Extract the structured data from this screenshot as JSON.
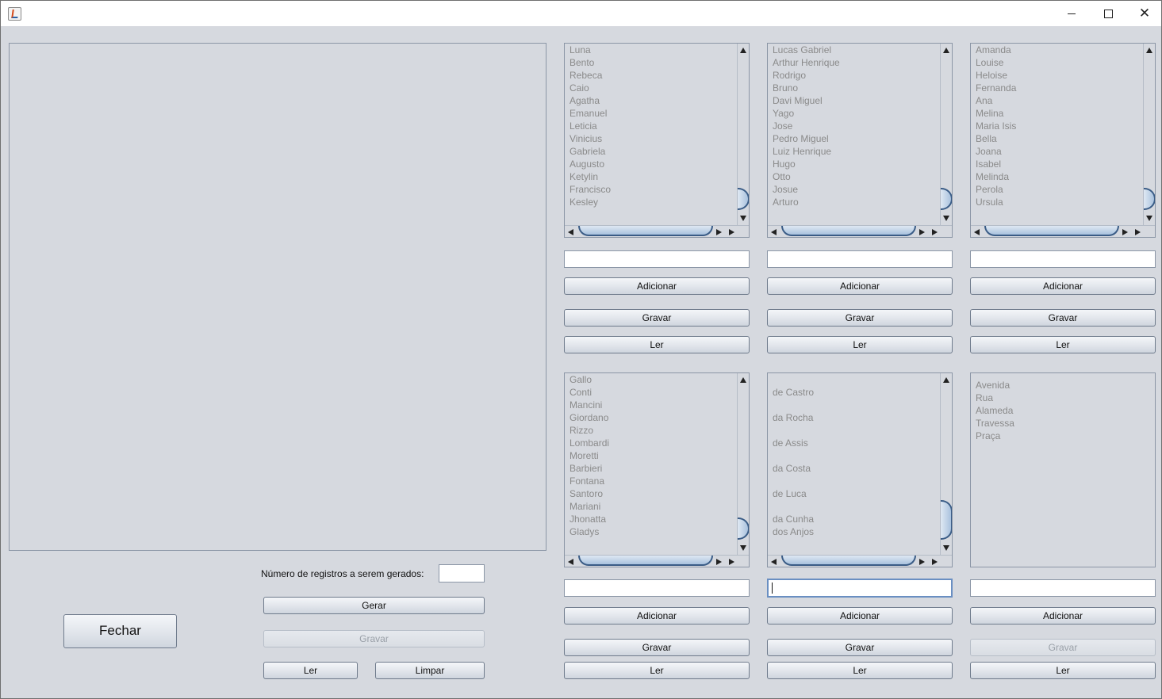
{
  "window": {
    "title": "",
    "controls": {
      "minimize": "minimize-icon",
      "maximize": "maximize-icon",
      "close": "✕"
    }
  },
  "lists": [
    {
      "items": [
        "Luna",
        "Bento",
        "Rebeca",
        "Caio",
        "Agatha",
        "Emanuel",
        "Leticia",
        "Vinicius",
        "Gabriela",
        "Augusto",
        "Ketylin",
        "Francisco",
        "Kesley"
      ]
    },
    {
      "items": [
        "Lucas Gabriel",
        "Arthur Henrique",
        "Rodrigo",
        "Bruno",
        "Davi Miguel",
        "Yago",
        "Jose",
        "Pedro Miguel",
        "Luiz Henrique",
        "Hugo",
        "Otto",
        "Josue",
        "Arturo"
      ]
    },
    {
      "items": [
        "Amanda",
        "Louise",
        "Heloise",
        "Fernanda",
        "Ana",
        "Melina",
        "Maria Isis",
        "Bella",
        "Joana",
        "Isabel",
        "Melinda",
        "Perola",
        "Ursula"
      ]
    },
    {
      "items": [
        "Gallo",
        "Conti",
        "Mancini",
        "Giordano",
        "Rizzo",
        "Lombardi",
        "Moretti",
        "Barbieri",
        "Fontana",
        "Santoro",
        "Mariani",
        "Jhonatta",
        "Gladys"
      ]
    },
    {
      "items": [
        "",
        "de Castro",
        "",
        "da Rocha",
        "",
        "de Assis",
        "",
        "da Costa",
        "",
        "de Luca",
        "",
        "da Cunha",
        "dos Anjos"
      ]
    },
    {
      "items": [
        "Avenida",
        "Rua",
        "Alameda",
        "Travessa",
        "Praça"
      ]
    }
  ],
  "buttons": {
    "adicionar": "Adicionar",
    "gravar": "Gravar",
    "ler": "Ler"
  },
  "generator": {
    "count_label": "Número de registros a serem gerados:",
    "count_value": "",
    "gerar": "Gerar",
    "gravar": "Gravar",
    "ler": "Ler",
    "limpar": "Limpar"
  },
  "fechar": "Fechar"
}
